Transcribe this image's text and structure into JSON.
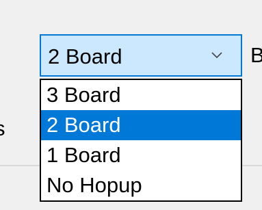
{
  "combo": {
    "selected_value": "2 Board",
    "expanded": true,
    "arrow_icon": "chevron-down-icon",
    "options": [
      {
        "label": "3 Board",
        "selected": false
      },
      {
        "label": "2 Board",
        "selected": true
      },
      {
        "label": "1 Board",
        "selected": false
      },
      {
        "label": "No Hopup",
        "selected": false
      }
    ]
  },
  "background_labels": {
    "left_fragment": "s",
    "right_fragment": "B"
  },
  "colors": {
    "window_bg": "#f0f0f0",
    "accent": "#0078d7",
    "combo_bg": "#cce8ff"
  }
}
